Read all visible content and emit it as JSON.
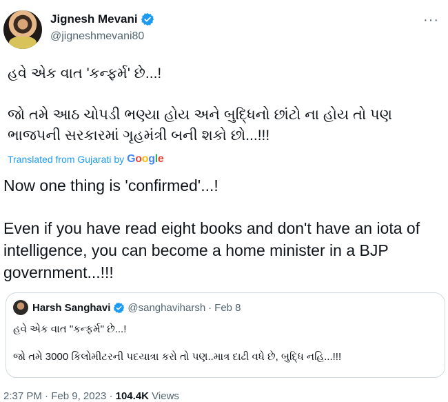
{
  "author": {
    "name": "Jignesh Mevani",
    "handle": "@jigneshmevani80"
  },
  "more_icon": "more-horizontal-icon",
  "tweet": {
    "gujarati_line1": "હવે એક વાત 'કન્ફર્મ' છે...!",
    "gujarati_line2": "જો તમે આઠ ચોપડી ભણ્યા હોય અને બુદ્ધિનો છાંટો ના હોય તો પણ ભાજપની સરકારમાં ગૃહમંત્રી બની શકો છો...!!!",
    "translated_from": "Translated from Gujarati by",
    "google": [
      "G",
      "o",
      "o",
      "g",
      "l",
      "e"
    ],
    "english_line1": "Now one thing is 'confirmed'...!",
    "english_line2": "Even if you have read eight books and don't have an iota of intelligence, you can become a home minister in a BJP government...!!!"
  },
  "quoted": {
    "name": "Harsh Sanghavi",
    "handle": "@sanghaviharsh",
    "separator": "·",
    "date": "Feb 8",
    "line1": "હવે એક વાત \"કન્ફર્મ\" છે...!",
    "line2": "જો તમે 3000 કિલોમીટરની પદયાત્રા કરો તો પણ..માત્ર દાઢી વધે છે, બુદ્ધિ નહિ...!!!"
  },
  "meta": {
    "time": "2:37 PM",
    "separator": "·",
    "date": "Feb 9, 2023",
    "views_count": "104.4K",
    "views_label": "Views"
  },
  "colors": {
    "link": "#1d9bf0",
    "verified": "#1d9bf0",
    "secondary_text": "#536471",
    "primary_text": "#0f1419"
  }
}
